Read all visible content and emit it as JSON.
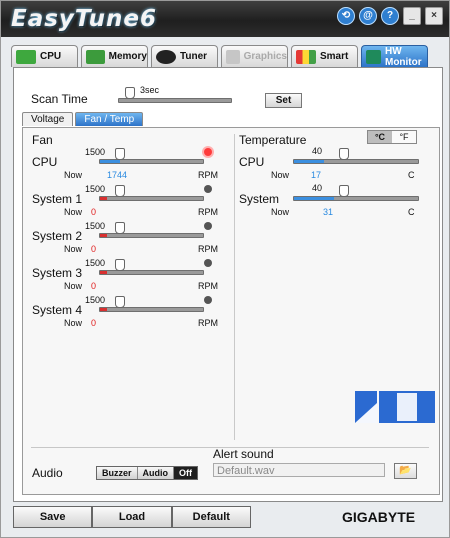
{
  "app": {
    "title": "EasyTune6",
    "brand": "GIGABYTE",
    "title_icons": [
      "window-restore-icon",
      "at-icon",
      "help-icon",
      "minimize-icon",
      "close-icon"
    ]
  },
  "tabs": [
    {
      "label": "CPU",
      "icon": "cpu-chip-icon"
    },
    {
      "label": "Memory",
      "icon": "memory-stick-icon"
    },
    {
      "label": "Tuner",
      "icon": "tuner-dial-icon"
    },
    {
      "label": "Graphics",
      "icon": "graphics-card-icon"
    },
    {
      "label": "Smart",
      "icon": "rubiks-cube-icon"
    },
    {
      "label": "HW Monitor",
      "icon": "monitor-icon"
    }
  ],
  "scan": {
    "label": "Scan Time",
    "value": "3sec",
    "set_button": "Set",
    "level": 0
  },
  "subtabs": {
    "voltage": "Voltage",
    "fan_temp": "Fan / Temp"
  },
  "fan": {
    "title": "Fan",
    "rows": [
      {
        "label": "CPU",
        "target": "1500",
        "now_label": "Now",
        "current": "1744",
        "unit": "RPM",
        "status": "alert",
        "slider_level": 0.2
      },
      {
        "label": "System 1",
        "target": "1500",
        "now_label": "Now",
        "current": "0",
        "unit": "RPM",
        "status": "off",
        "slider_level": 0.05
      },
      {
        "label": "System 2",
        "target": "1500",
        "now_label": "Now",
        "current": "0",
        "unit": "RPM",
        "status": "off",
        "slider_level": 0.05
      },
      {
        "label": "System 3",
        "target": "1500",
        "now_label": "Now",
        "current": "0",
        "unit": "RPM",
        "status": "off",
        "slider_level": 0.05
      },
      {
        "label": "System 4",
        "target": "1500",
        "now_label": "Now",
        "current": "0",
        "unit": "RPM",
        "status": "off",
        "slider_level": 0.05
      }
    ]
  },
  "temperature": {
    "title": "Temperature",
    "units": [
      "°C",
      "°F"
    ],
    "rows": [
      {
        "label": "CPU",
        "threshold": "40",
        "now_label": "Now",
        "current": "17",
        "unit": "C",
        "slider_level": 0.3
      },
      {
        "label": "System",
        "threshold": "40",
        "now_label": "Now",
        "current": "31",
        "unit": "C",
        "slider_level": 0.3
      }
    ]
  },
  "alert": {
    "title": "Alert sound",
    "file": "Default.wav"
  },
  "audio": {
    "label": "Audio",
    "options": [
      "Buzzer",
      "Audio",
      "Off"
    ],
    "selected": "Off"
  },
  "bottom_buttons": [
    "Save",
    "Load",
    "Default"
  ],
  "colors": {
    "accent": "#3b8fe0",
    "alert": "#ff3b3b",
    "current_value": "#2a8ae0"
  }
}
